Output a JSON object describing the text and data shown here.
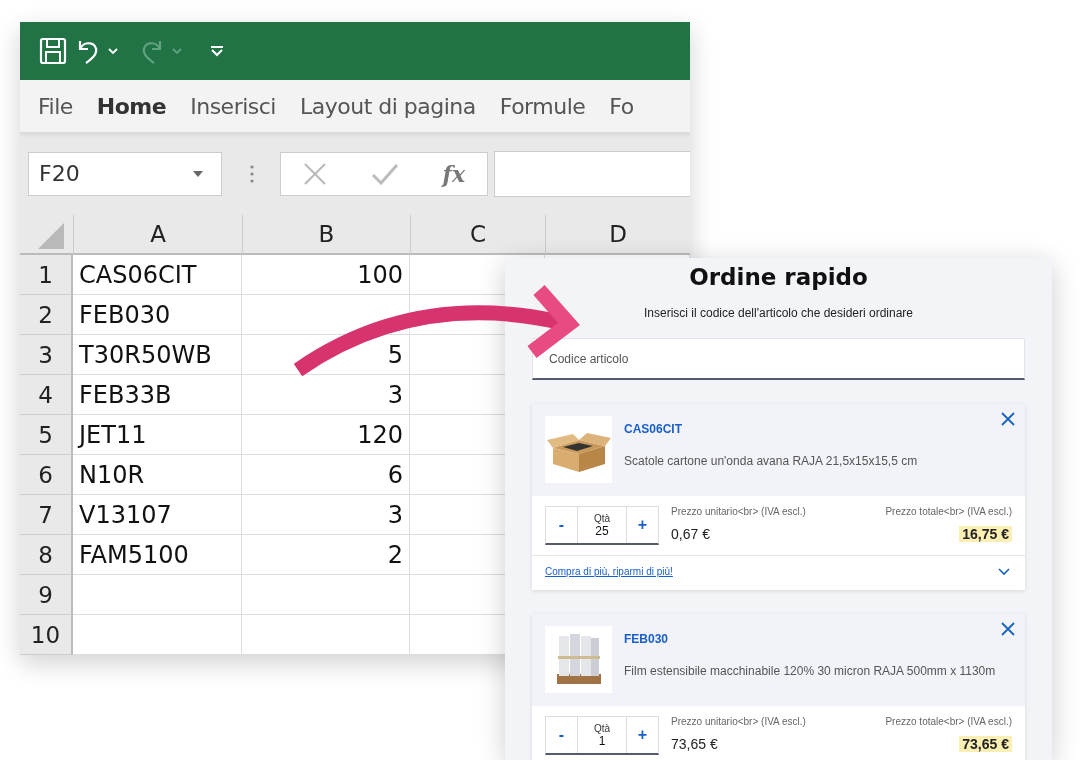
{
  "spreadsheet": {
    "ribbon_tabs": [
      {
        "label": "File",
        "selected": false
      },
      {
        "label": "Home",
        "selected": true
      },
      {
        "label": "Inserisci",
        "selected": false
      },
      {
        "label": "Layout di pagina",
        "selected": false
      },
      {
        "label": "Formule",
        "selected": false
      },
      {
        "label": "Fo",
        "selected": false
      }
    ],
    "name_box": "F20",
    "function_button": "fx",
    "columns": [
      "A",
      "B",
      "C",
      "D"
    ],
    "rows": [
      {
        "number": "1",
        "cells": [
          "CAS06CIT",
          "100"
        ]
      },
      {
        "number": "2",
        "cells": [
          "FEB030"
        ]
      },
      {
        "number": "3",
        "cells": [
          "T30R50WB",
          "5"
        ]
      },
      {
        "number": "4",
        "cells": [
          "FEB33B",
          "3"
        ]
      },
      {
        "number": "5",
        "cells": [
          "JET11",
          "120"
        ]
      },
      {
        "number": "6",
        "cells": [
          "N10R",
          "6"
        ]
      },
      {
        "number": "7",
        "cells": [
          "V13107",
          "3"
        ]
      },
      {
        "number": "8",
        "cells": [
          "FAM5100",
          "2"
        ]
      },
      {
        "number": "9"
      },
      {
        "number": "10"
      }
    ]
  },
  "quick_order": {
    "title": "Ordine rapido",
    "subtitle": "Inserisci il codice dell'articolo che desideri ordinare",
    "search": {
      "placeholder": "Codice articolo"
    },
    "items": [
      {
        "code": "CAS06CIT",
        "description": "Scatole cartone un'onda avana RAJA 21,5x15x15,5 cm",
        "minus": "-",
        "qty_label": "Qtà",
        "qty": "25",
        "plus": "+",
        "unit_price_label": "Prezzo unitario<br> (IVA escl.)",
        "unit_price": "0,67 €",
        "total_label": "Prezzo totale<br> (IVA escl.)",
        "total": "16,75 €",
        "link": "Compra di più, riparmi di più!"
      },
      {
        "code": "FEB030",
        "description": "Film estensibile macchinabile 120% 30 micron RAJA 500mm x 1130m",
        "minus": "-",
        "qty_label": "Qtà",
        "qty": "1",
        "plus": "+",
        "unit_price_label": "Prezzo unitario<br> (IVA escl.)",
        "unit_price": "73,65 €",
        "total_label": "Prezzo totale<br> (IVA escl.)",
        "total": "73,65 €"
      }
    ]
  }
}
